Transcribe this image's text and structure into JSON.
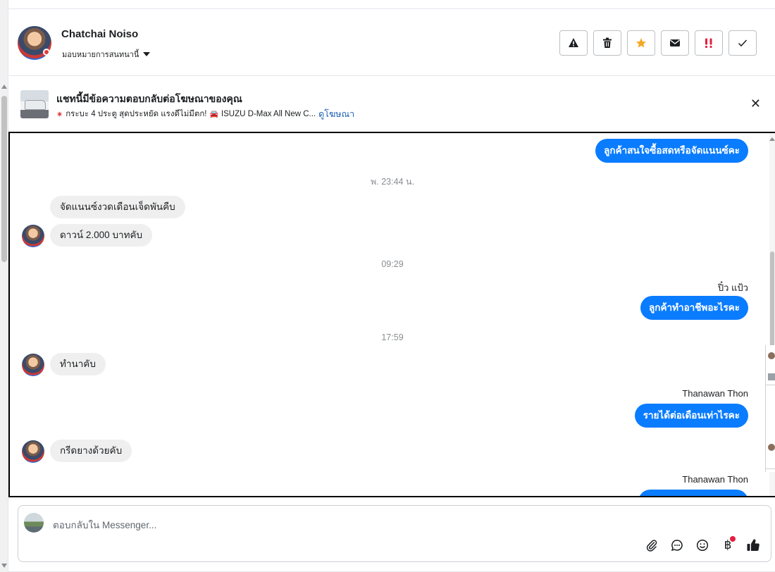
{
  "header": {
    "contact_name": "Chatchai Noiso",
    "assign_label": "มอบหมายการสนทนานี้",
    "actions": [
      {
        "name": "report-icon",
        "label": "report"
      },
      {
        "name": "trash-icon",
        "label": "delete"
      },
      {
        "name": "star-icon",
        "label": "star"
      },
      {
        "name": "mail-icon",
        "label": "mark-unread"
      },
      {
        "name": "priority-icon",
        "label": "priority"
      },
      {
        "name": "check-icon",
        "label": "done"
      }
    ]
  },
  "ad_banner": {
    "title": "แชทนี้มีข้อความตอบกลับต่อโฆษณาของคุณ",
    "subtitle": "กระบะ 4 ประตู สุดประหยัด แรงดีไม่มีตก!",
    "ad_name": "ISUZU D-Max All New C...",
    "view_ad_link": "ดูโฆษณา"
  },
  "messages": {
    "m1": "ลูกค้าสนใจซื้อสดหรือจัดแนนซ์คะ",
    "t1": "พ. 23:44 น.",
    "m2": "จัดแนนซ์งวดเดือนเจ็ดพันคืบ",
    "m3": "ดาวน์ 2.000 บาทคับ",
    "t2": "09:29",
    "s1": "ปิ๋ว แป้ว",
    "m4": "ลูกค้าทำอาชีพอะไรคะ",
    "t3": "17:59",
    "m5": "ทำนาคับ",
    "s2": "Thanawan Thon",
    "m6": "รายได้ต่อเดือนเท่าไรคะ",
    "m7": "กรีดยางด้วยคับ",
    "s3": "Thanawan Thon"
  },
  "composer": {
    "placeholder": "ตอบกลับใน Messenger..."
  },
  "colors": {
    "outgoing_bubble": "#0a7cff",
    "incoming_bubble": "#efefef",
    "priority": "#e41e3f",
    "star": "#f5a623"
  }
}
